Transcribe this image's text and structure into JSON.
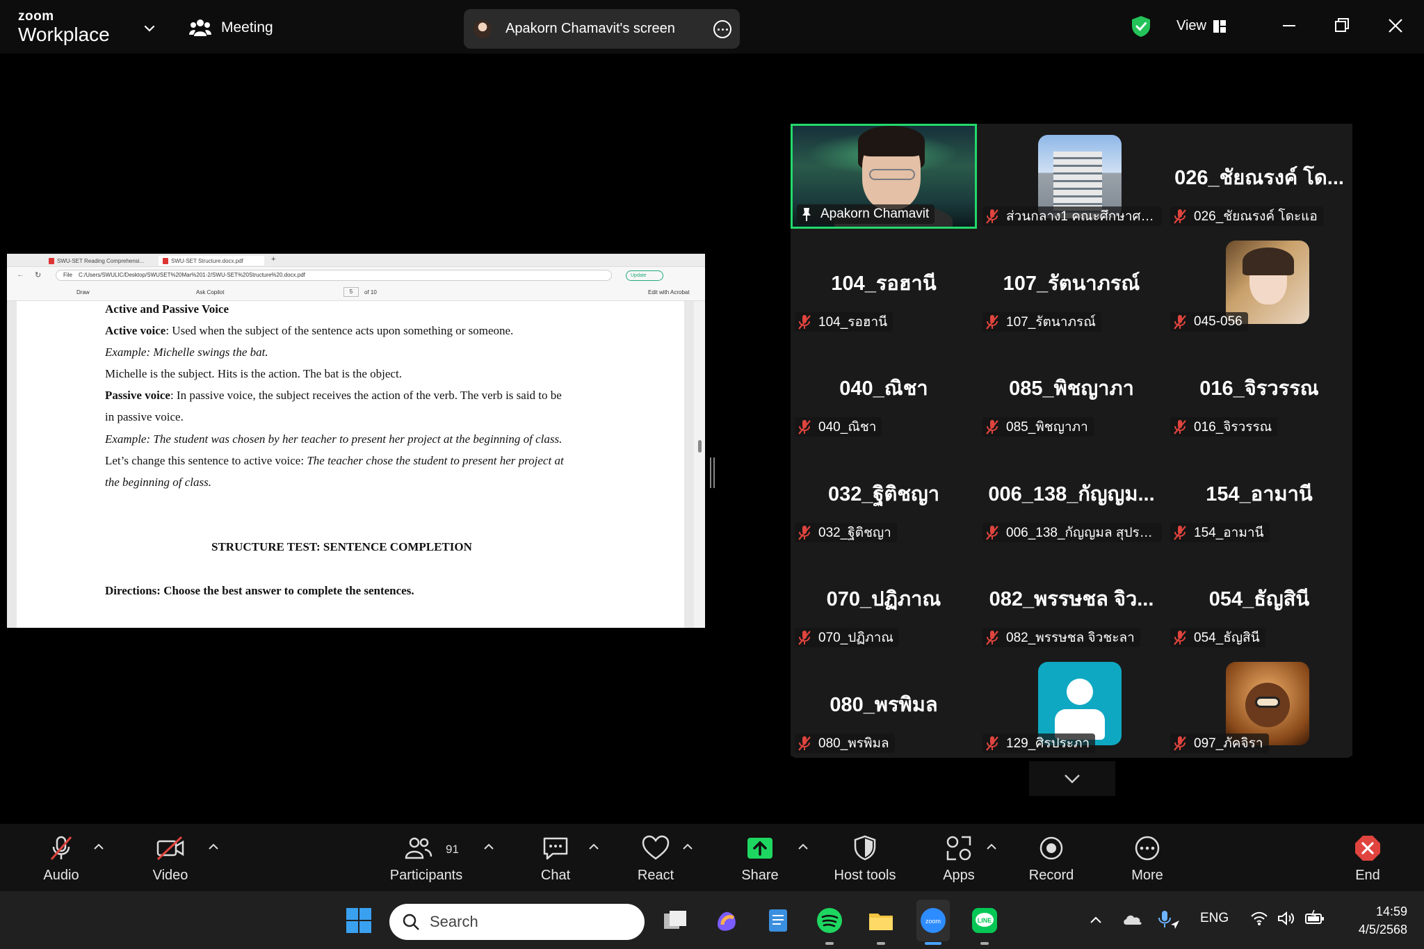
{
  "topbar": {
    "brand_small": "zoom",
    "brand_big": "Workplace",
    "meeting_label": "Meeting",
    "share_label": "Apakorn Chamavit's screen",
    "view_label": "View"
  },
  "shared_screen": {
    "browser": {
      "tab1": "SWU-SET Reading Comprehensi...",
      "tab2": "SWU-SET Structure.docx.pdf",
      "url": "C:/Users/SWULIC/Desktop/SWUSET%20Mar%201-2/SWU-SET%20Structure%20.docx.pdf",
      "file_label": "File",
      "update_label": "Update"
    },
    "pdf_toolbar": {
      "draw": "Draw",
      "ask_copilot": "Ask Copilot",
      "page_current": "5",
      "page_total": "of 10",
      "edit_acrobat": "Edit with Acrobat"
    },
    "lines": {
      "heading": "Active and Passive Voice",
      "active_term": "Active voice",
      "active_def": ": Used when the subject of the sentence acts upon something or someone.",
      "example1": "Example: Michelle swings the bat.",
      "explain1": "Michelle is the subject. Hits is the action. The bat is the object.",
      "passive_term": "Passive voice",
      "passive_def": ": In passive voice, the subject receives the action of the verb. The verb is said to be",
      "passive_def2": "in passive voice.",
      "example2": "Example: The student was chosen by her teacher to present her project at the beginning of class.",
      "change_prefix": "Let’s change this sentence to active voice: ",
      "change_italic": "The teacher chose the student to present her project at",
      "change_italic2": "the beginning of class.",
      "section_title": "STRUCTURE TEST: SENTENCE COMPLETION",
      "directions": "Directions: Choose the best answer to complete the sentences."
    }
  },
  "participants": [
    {
      "big": "",
      "name": "Apakorn Chamavit",
      "type": "video"
    },
    {
      "big": "",
      "name": "ส่วนกลาง1 คณะศึกษาศาส...",
      "type": "building"
    },
    {
      "big": "026_ชัยณรงค์ โด...",
      "name": "026_ชัยณรงค์ โดะแอ",
      "type": "text"
    },
    {
      "big": "104_รอฮานี",
      "name": "104_รอฮานี",
      "type": "text"
    },
    {
      "big": "107_รัตนาภรณ์",
      "name": "107_รัตนาภรณ์",
      "type": "text"
    },
    {
      "big": "",
      "name": "045-056",
      "type": "photo"
    },
    {
      "big": "040_ณิชา",
      "name": "040_ณิชา",
      "type": "text"
    },
    {
      "big": "085_พิชญาภา",
      "name": "085_พิชญาภา",
      "type": "text"
    },
    {
      "big": "016_จิรวรรณ",
      "name": "016_จิรวรรณ",
      "type": "text"
    },
    {
      "big": "032_ฐิติชญา",
      "name": "032_ฐิติชญา",
      "type": "text"
    },
    {
      "big": "006_138_กัญญม...",
      "name": "006_138_กัญญมล สุประวี...",
      "type": "text"
    },
    {
      "big": "154_อามานี",
      "name": "154_อามานี",
      "type": "text"
    },
    {
      "big": "070_ปฏิภาณ",
      "name": "070_ปฏิภาณ",
      "type": "text"
    },
    {
      "big": "082_พรรษชล จิว...",
      "name": "082_พรรษชล จิวชะลา",
      "type": "text"
    },
    {
      "big": "054_ธัญสินี",
      "name": "054_ธัญสินี",
      "type": "text"
    },
    {
      "big": "080_พรพิมล",
      "name": "080_พรพิมล",
      "type": "text"
    },
    {
      "big": "",
      "name": "129_ศิรประภา",
      "type": "default"
    },
    {
      "big": "",
      "name": "097_ภัคจิรา",
      "type": "cartoon"
    }
  ],
  "toolbar": {
    "audio": "Audio",
    "video": "Video",
    "participants": "Participants",
    "participant_count": "91",
    "chat": "Chat",
    "react": "React",
    "share": "Share",
    "host_tools": "Host tools",
    "apps": "Apps",
    "record": "Record",
    "more": "More",
    "end": "End"
  },
  "taskbar": {
    "search_placeholder": "Search",
    "language": "ENG",
    "time": "14:59",
    "date": "4/5/2568"
  },
  "colors": {
    "active_speaker": "#23d96b",
    "share_green": "#1ed760",
    "muted_red": "#e0443e",
    "end_red": "#e0443e"
  }
}
